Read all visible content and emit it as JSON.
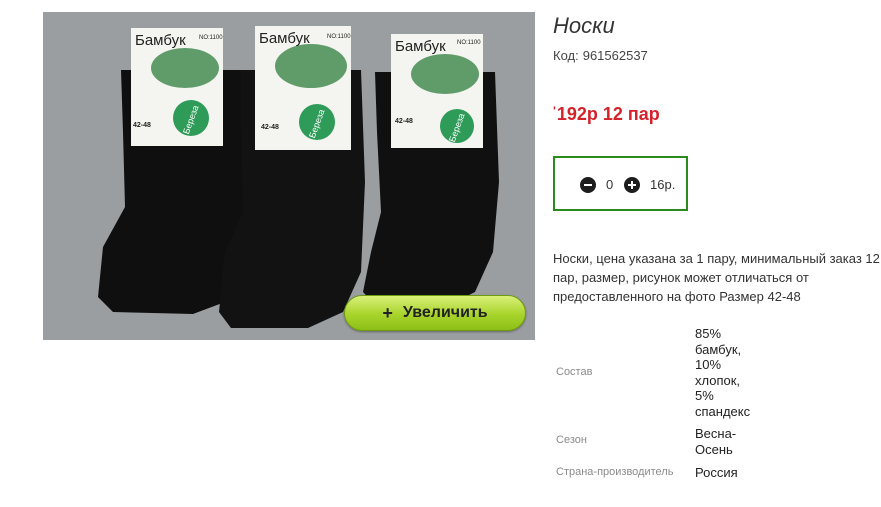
{
  "product": {
    "title": "Носки",
    "code_label": "Код:",
    "code_value": "961562537",
    "price_mark": "'",
    "price": "192р 12 пар",
    "quantity": "0",
    "unit_price": "16р.",
    "description": "Носки, цена указана за 1 пару, минимальный заказ 12 пар, размер, рисунок может отличаться от предоставленного на фото Размер 42-48"
  },
  "image": {
    "zoom_button": "Увеличить",
    "pack_brand": "Бамбук",
    "pack_no": "NO:1100",
    "pack_size": "42-48",
    "pack_birch": "Береза"
  },
  "specs": [
    {
      "label": "Состав",
      "value": "85%\nбамбук,\n10%\nхлопок,\n5%\nспандекс"
    },
    {
      "label": "Сезон",
      "value": "Весна-\nОсень"
    },
    {
      "label": "Страна-производитель",
      "value": "Россия"
    }
  ],
  "colors": {
    "price": "#d4222a",
    "qty_border": "#2b8a1e",
    "zoom_button": "#a8d42b",
    "photo_bg": "#9a9ea1"
  },
  "icons": {
    "minus": "minus-circle-icon",
    "plus": "plus-circle-icon"
  }
}
